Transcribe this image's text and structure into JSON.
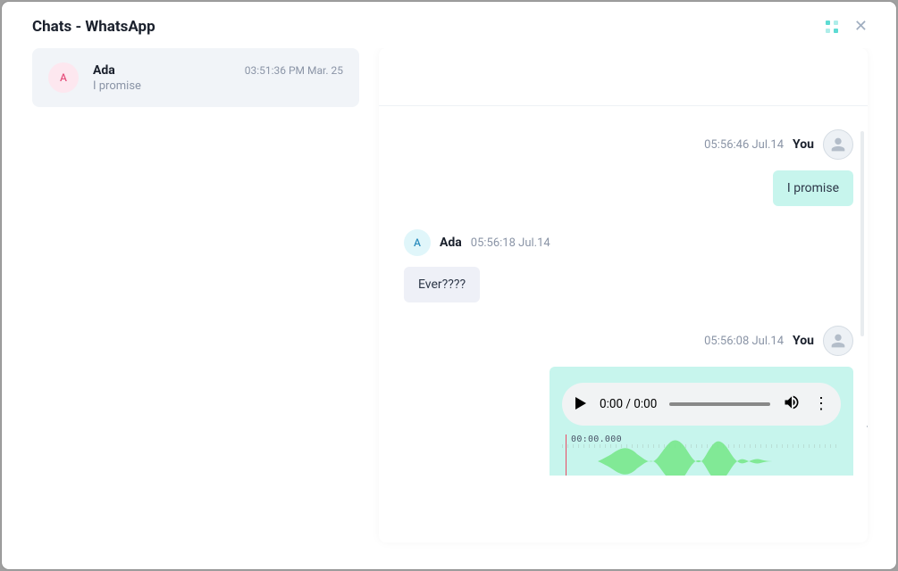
{
  "header": {
    "title": "Chats - WhatsApp"
  },
  "sidebar": {
    "chats": [
      {
        "avatar_letter": "A",
        "name": "Ada",
        "preview": "I promise",
        "time": "03:51:36 PM Mar. 25"
      }
    ]
  },
  "messages": [
    {
      "side": "right",
      "time": "05:56:46 Jul.14",
      "name": "You",
      "avatar": "user",
      "bubble_style": "teal",
      "text": "I promise"
    },
    {
      "side": "left",
      "time": "05:56:18 Jul.14",
      "name": "Ada",
      "avatar_letter": "A",
      "bubble_style": "gray",
      "text": "Ever????"
    },
    {
      "side": "right",
      "time": "05:56:08 Jul.14",
      "name": "You",
      "avatar": "user",
      "type": "audio",
      "audio_time": "0:00 / 0:00",
      "waveform_time": "00:00.000"
    }
  ]
}
